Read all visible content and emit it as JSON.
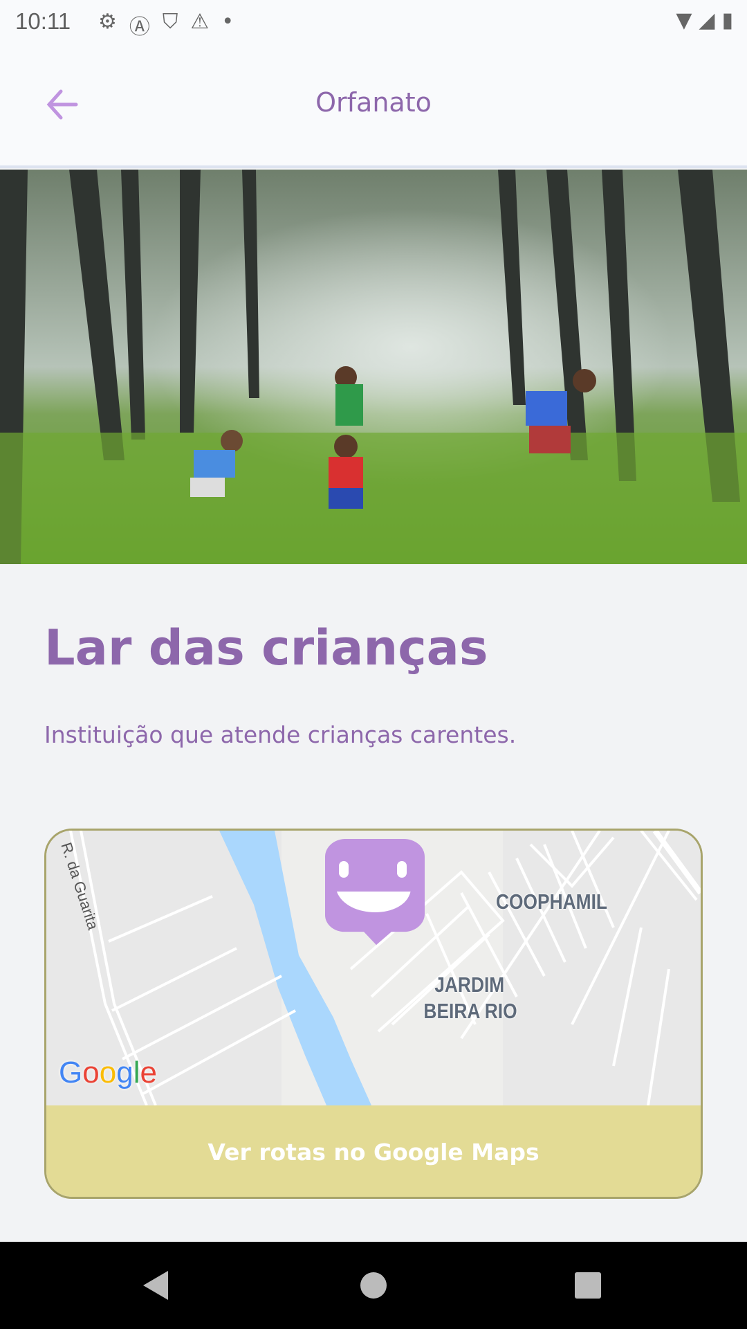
{
  "status_bar": {
    "time": "10:11",
    "icons": [
      "gear-icon",
      "a-icon",
      "shield-play-icon",
      "warning-icon",
      "dot-icon"
    ],
    "right_icons": [
      "wifi-icon",
      "signal-icon",
      "battery-icon"
    ]
  },
  "header": {
    "title": "Orfanato",
    "back_icon": "arrow-left-icon"
  },
  "orphanage": {
    "name": "Lar das crianças",
    "description": "Instituição que atende crianças carentes."
  },
  "map": {
    "labels": [
      "COOPHAMIL",
      "JARDIM",
      "BEIRA RIO"
    ],
    "road": "R. da Guarita",
    "logo": "Google",
    "marker_icon": "smile-marker-icon",
    "button_label": "Ver rotas no Google Maps"
  },
  "colors": {
    "primary": "#8d67ab",
    "marker": "#c094e0",
    "button": "#e3db95",
    "river": "#aad7fd"
  },
  "nav": [
    "back-triangle-icon",
    "home-circle-icon",
    "recents-square-icon"
  ]
}
